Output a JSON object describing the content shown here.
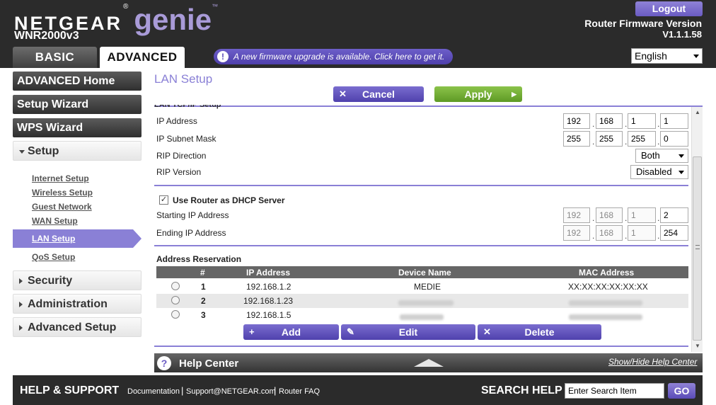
{
  "header": {
    "brand": "NETGEAR",
    "brand_reg": "®",
    "product": "genie",
    "product_tm": "™",
    "model": "WNR2000v3",
    "logout_label": "Logout",
    "firmware_label": "Router Firmware Version",
    "firmware_version": "V1.1.1.58",
    "tabs": {
      "basic": "BASIC",
      "advanced": "ADVANCED"
    },
    "firmware_notice": "A new firmware upgrade is available. Click here to get it.",
    "firmware_notice_icon": "!",
    "language": "English"
  },
  "sidebar": {
    "advanced_home": "ADVANCED Home",
    "setup_wizard": "Setup Wizard",
    "wps_wizard": "WPS Wizard",
    "setup": "Setup",
    "setup_items": {
      "internet": "Internet Setup",
      "wireless": "Wireless Setup",
      "guest": "Guest Network",
      "wan": "WAN Setup",
      "lan": "LAN Setup",
      "qos": "QoS Setup"
    },
    "security": "Security",
    "administration": "Administration",
    "advanced_setup": "Advanced Setup"
  },
  "content": {
    "title": "LAN Setup",
    "cancel_label": "Cancel",
    "apply_label": "Apply",
    "section_lan_tcpip": "LAN TCP/IP Setup",
    "ip_address_label": "IP Address",
    "ip_address": [
      "192",
      "168",
      "1",
      "1"
    ],
    "subnet_label": "IP Subnet Mask",
    "subnet": [
      "255",
      "255",
      "255",
      "0"
    ],
    "rip_direction_label": "RIP Direction",
    "rip_direction": "Both",
    "rip_version_label": "RIP Version",
    "rip_version": "Disabled",
    "dhcp_label": "Use Router as DHCP Server",
    "dhcp_checked": true,
    "start_ip_label": "Starting IP Address",
    "start_ip": [
      "192",
      "168",
      "1",
      "2"
    ],
    "end_ip_label": "Ending IP Address",
    "end_ip": [
      "192",
      "168",
      "1",
      "254"
    ],
    "reservation_label": "Address Reservation",
    "columns": {
      "num": "#",
      "ip": "IP Address",
      "device": "Device Name",
      "mac": "MAC Address"
    },
    "rows": [
      {
        "num": "1",
        "ip": "192.168.1.2",
        "device": "MEDIE",
        "mac": "XX:XX:XX:XX:XX:XX"
      },
      {
        "num": "2",
        "ip": "192.168.1.23",
        "device": "",
        "mac": ""
      },
      {
        "num": "3",
        "ip": "192.168.1.5",
        "device": "",
        "mac": ""
      }
    ],
    "add_label": "Add",
    "edit_label": "Edit",
    "delete_label": "Delete"
  },
  "help": {
    "title": "Help Center",
    "toggle": "Show/Hide Help Center",
    "icon": "?"
  },
  "footer": {
    "title": "HELP & SUPPORT",
    "links": {
      "documentation": "Documentation",
      "support": "Support@NETGEAR.com",
      "faq": "Router FAQ"
    },
    "separator": "|",
    "search_label": "SEARCH HELP",
    "search_value": "Enter Search Item",
    "go_label": "GO"
  },
  "colors": {
    "accent": "#8a80d6",
    "apply": "#6fae32",
    "dark": "#2b2b2b"
  }
}
